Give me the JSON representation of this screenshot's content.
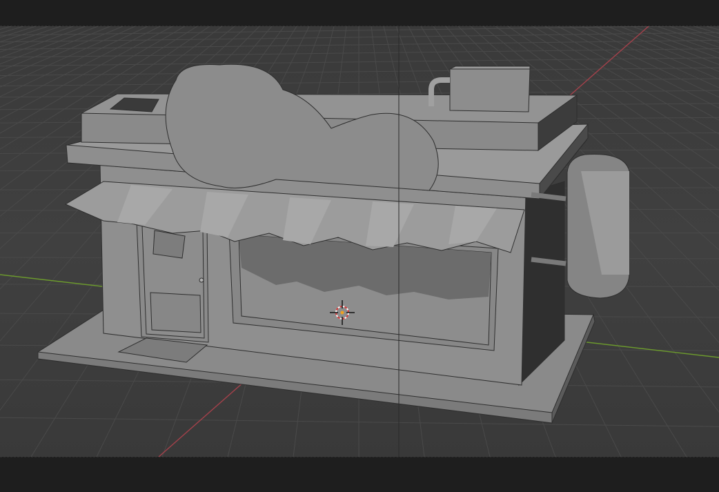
{
  "viewport": {
    "background_color": "#3d3d3d",
    "grid_color": "#4a4a4a",
    "x_axis_color": "#a4414b",
    "y_axis_color": "#6c9a2d",
    "model_base_color": "#8c8c8c",
    "icons": {
      "cursor": "3d-cursor-icon"
    }
  }
}
